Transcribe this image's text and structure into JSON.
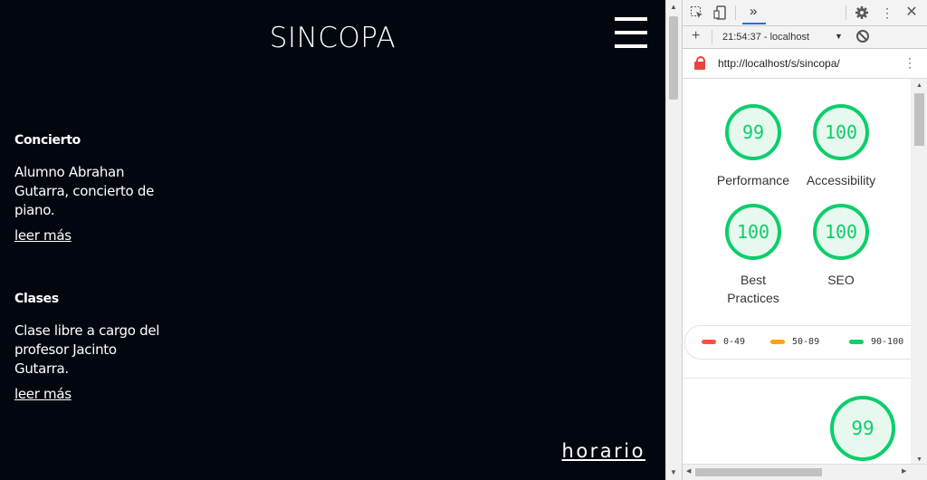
{
  "site": {
    "title": "SINCOPA",
    "posts": [
      {
        "title": "Concierto",
        "body": "Alumno Abrahan Gutarra, concierto de piano.",
        "link": "leer más"
      },
      {
        "title": "Clases",
        "body": "Clase libre a cargo del profesor Jacinto Gutarra.",
        "link": "leer más"
      }
    ],
    "footer_link": "horario",
    "background": "#01060f"
  },
  "devtools": {
    "toolbar_icons": [
      "inspect-icon",
      "device-toggle-icon",
      "more-tabs-icon",
      "settings-icon",
      "kebab-menu-icon",
      "close-icon"
    ],
    "more_tabs_glyph": "»",
    "run_label": "21:54:37 - localhost",
    "report_url": "http://localhost/s/sincopa/",
    "scores": [
      {
        "value": "99",
        "label": "Performance"
      },
      {
        "value": "100",
        "label": "Accessibility"
      },
      {
        "value": "100",
        "label": "Best Practices"
      },
      {
        "value": "100",
        "label": "SEO"
      }
    ],
    "legend": [
      {
        "range": "0-49",
        "color": "#ff4e42"
      },
      {
        "range": "50-89",
        "color": "#ffa400"
      },
      {
        "range": "90-100",
        "color": "#0cce6b"
      }
    ],
    "summary_score": "99",
    "pass_color": "#0cce6b"
  }
}
